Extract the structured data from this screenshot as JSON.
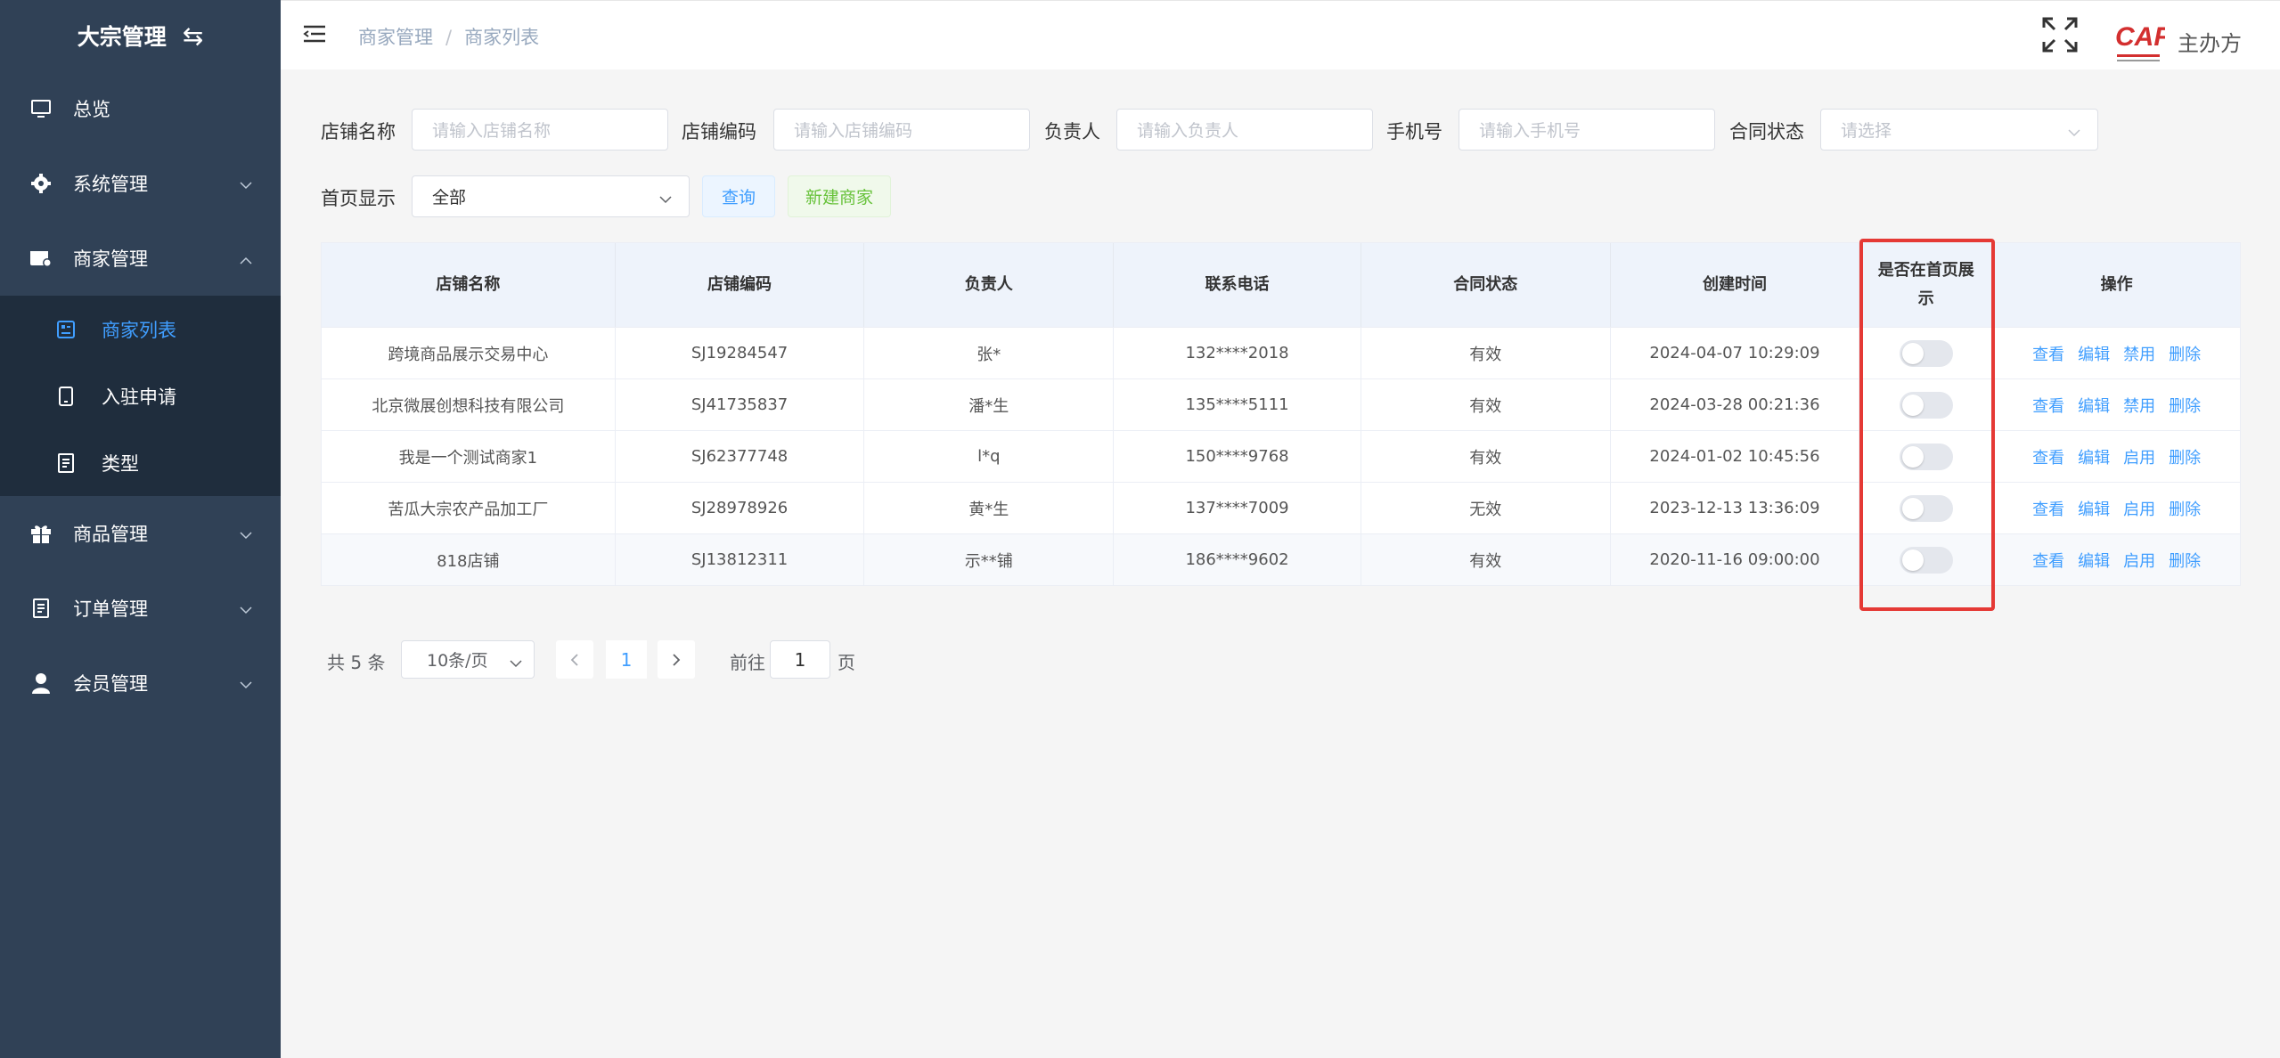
{
  "sidebar": {
    "brand": "大宗管理",
    "items": [
      {
        "label": "总览"
      },
      {
        "label": "系统管理"
      },
      {
        "label": "商家管理"
      },
      {
        "label": "商品管理"
      },
      {
        "label": "订单管理"
      },
      {
        "label": "会员管理"
      }
    ],
    "sub_items": [
      {
        "label": "商家列表"
      },
      {
        "label": "入驻申请"
      },
      {
        "label": "类型"
      }
    ]
  },
  "header": {
    "breadcrumb": [
      "商家管理",
      "商家列表"
    ],
    "separator": "/",
    "logo_text": "CAF",
    "org_name": "主办方"
  },
  "filters": {
    "shop_name_label": "店铺名称",
    "shop_name_placeholder": "请输入店铺名称",
    "shop_code_label": "店铺编码",
    "shop_code_placeholder": "请输入店铺编码",
    "owner_label": "负责人",
    "owner_placeholder": "请输入负责人",
    "phone_label": "手机号",
    "phone_placeholder": "请输入手机号",
    "contract_label": "合同状态",
    "contract_placeholder": "请选择",
    "homepage_label": "首页显示",
    "homepage_value": "全部",
    "query_button": "查询",
    "new_button": "新建商家"
  },
  "table": {
    "headers": [
      "店铺名称",
      "店铺编码",
      "负责人",
      "联系电话",
      "合同状态",
      "创建时间",
      "是否在首页展示",
      "操作"
    ],
    "rows": [
      {
        "name": "跨境商品展示交易中心",
        "code": "SJ19284547",
        "owner": "张*",
        "phone": "132****2018",
        "contract": "有效",
        "created": "2024-04-07 10:29:09",
        "home": false,
        "toggle": "禁用"
      },
      {
        "name": "北京微展创想科技有限公司",
        "code": "SJ41735837",
        "owner": "潘*生",
        "phone": "135****5111",
        "contract": "有效",
        "created": "2024-03-28 00:21:36",
        "home": false,
        "toggle": "禁用"
      },
      {
        "name": "我是一个测试商家1",
        "code": "SJ62377748",
        "owner": "l*q",
        "phone": "150****9768",
        "contract": "有效",
        "created": "2024-01-02 10:45:56",
        "home": false,
        "toggle": "启用"
      },
      {
        "name": "苦瓜大宗农产品加工厂",
        "code": "SJ28978926",
        "owner": "黄*生",
        "phone": "137****7009",
        "contract": "无效",
        "created": "2023-12-13 13:36:09",
        "home": false,
        "toggle": "启用"
      },
      {
        "name": "818店铺",
        "code": "SJ13812311",
        "owner": "示**铺",
        "phone": "186****9602",
        "contract": "有效",
        "created": "2020-11-16 09:00:00",
        "home": false,
        "toggle": "启用"
      }
    ],
    "ops": {
      "view": "查看",
      "edit": "编辑",
      "delete": "删除"
    }
  },
  "pagination": {
    "total": "共 5 条",
    "page_size": "10条/页",
    "current": "1",
    "goto_label": "前往",
    "goto_value": "1",
    "page_suffix": "页"
  },
  "colors": {
    "sidebar": "#304156",
    "submenu": "#1f2d3d",
    "accent": "#409eff",
    "highlight": "#e53935"
  }
}
